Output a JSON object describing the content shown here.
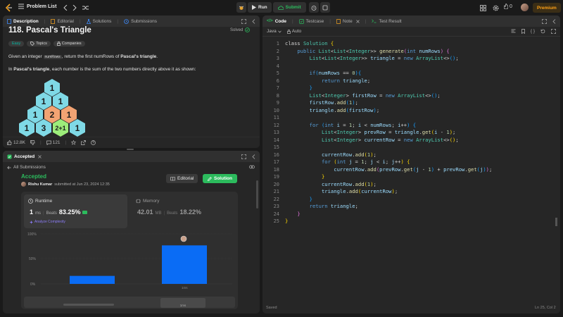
{
  "topbar": {
    "problem_list": "Problem List",
    "run": "Run",
    "submit": "Submit",
    "fire_count": "0",
    "premium": "Premium"
  },
  "left_tabs": {
    "description": "Description",
    "editorial": "Editorial",
    "solutions": "Solutions",
    "submissions": "Submissions"
  },
  "problem": {
    "title": "118. Pascal's Triangle",
    "solved": "Solved",
    "difficulty": "Easy",
    "topics": "Topics",
    "companies": "Companies",
    "desc_1_a": "Given an integer ",
    "desc_1_code": "numRows",
    "desc_1_b": ", return the first numRows of ",
    "desc_1_bold": "Pascal's triangle",
    "desc_1_c": ".",
    "desc_2_bold": "Pascal's triangle",
    "desc_2_rest": ", each number is the sum of the two numbers directly above it as shown:",
    "desc_2_prefix": "In ",
    "triangle": [
      "1",
      "1",
      "1",
      "1",
      "2",
      "1",
      "1",
      "3",
      "2+1",
      "1"
    ],
    "likes": "12.8K",
    "comments": "121"
  },
  "accepted_panel": {
    "tab_label": "Accepted",
    "back_label": "All Submissions",
    "status": "Accepted",
    "user": "Rishu Kumar",
    "submitted_at": "submitted at Jun 23, 2024 12:35",
    "editorial_btn": "Editorial",
    "solution_btn": "Solution",
    "runtime_label": "Runtime",
    "runtime_value": "1",
    "runtime_unit": "ms",
    "beats_label": "Beats",
    "runtime_beats": "83.25%",
    "analyze": "Analyze Complexity",
    "memory_label": "Memory",
    "memory_value": "42.01",
    "memory_unit": "MB",
    "memory_beats": "18.22%",
    "chart_ticks": [
      "100%",
      "50%",
      "0%"
    ],
    "chart_xlabel": "1ms",
    "bottom_tick": "1ms"
  },
  "chart_data": {
    "type": "bar",
    "categories": [
      "",
      "1ms"
    ],
    "values": [
      16,
      77
    ],
    "ylim": [
      0,
      100
    ],
    "title": "",
    "xlabel": "",
    "ylabel": ""
  },
  "right_tabs": {
    "code": "Code",
    "testcase": "Testcase",
    "note": "Note",
    "test_result": "Test Result",
    "language": "Java",
    "auto": "Auto"
  },
  "editor": {
    "status_left": "Saved",
    "status_right": "Ln 25, Col 2"
  },
  "colors": {
    "accent_green": "#2cbb5d",
    "easy_cyan": "#00b8a3",
    "premium": "#ffa116",
    "bar_blue": "#0a6cf5"
  }
}
